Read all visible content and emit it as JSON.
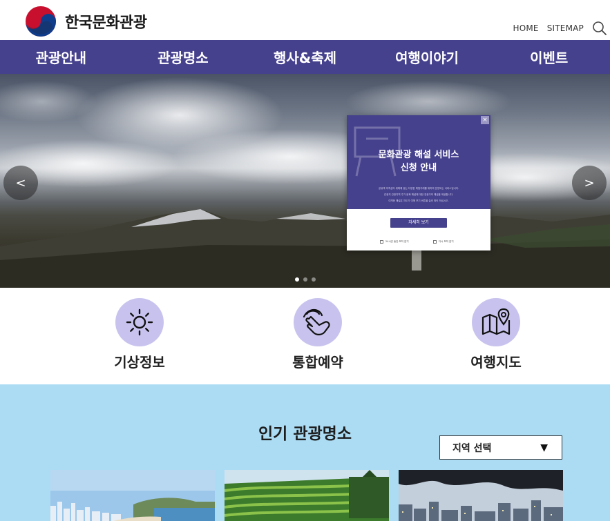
{
  "header": {
    "logo_text": "한국문화관광",
    "links": {
      "home": "HOME",
      "sitemap": "SITEMAP"
    }
  },
  "nav": {
    "items": [
      "관광안내",
      "관광명소",
      "행사&축제",
      "여행이야기",
      "이벤트"
    ]
  },
  "hero": {
    "prev": "<",
    "next": ">",
    "slide_count": 3,
    "active_slide": 1
  },
  "popup": {
    "close": "×",
    "title_line1": "문화관광 해설 서비스",
    "title_line2": "신청 안내",
    "desc_line1": "공유객 여객섬의 위해에 걸는 다양한 체험거래를 위하여 운영되는 서비스입니다.",
    "desc_line2": "관광지 관한지역 주가 문화 해설에 대한 전문가의 해설을 제공합니다.",
    "desc_line3": "여객한 해설은 지도가 여해 보기 버튼을 눌러 확인 하십시오.",
    "button": "자세히 보기",
    "opt_today": "24시간 동안 보지 않기",
    "opt_close": "다시 보지 않기"
  },
  "quick": {
    "weather": "기상정보",
    "reserve": "통합예약",
    "map": "여행지도"
  },
  "popular": {
    "title": "인기 관광명소",
    "select_label": "지역 선택",
    "select_arrow": "▼"
  },
  "colors": {
    "nav": "#46418d",
    "quick_circle": "#c8c3ee",
    "section_bg": "#acdcf3"
  }
}
